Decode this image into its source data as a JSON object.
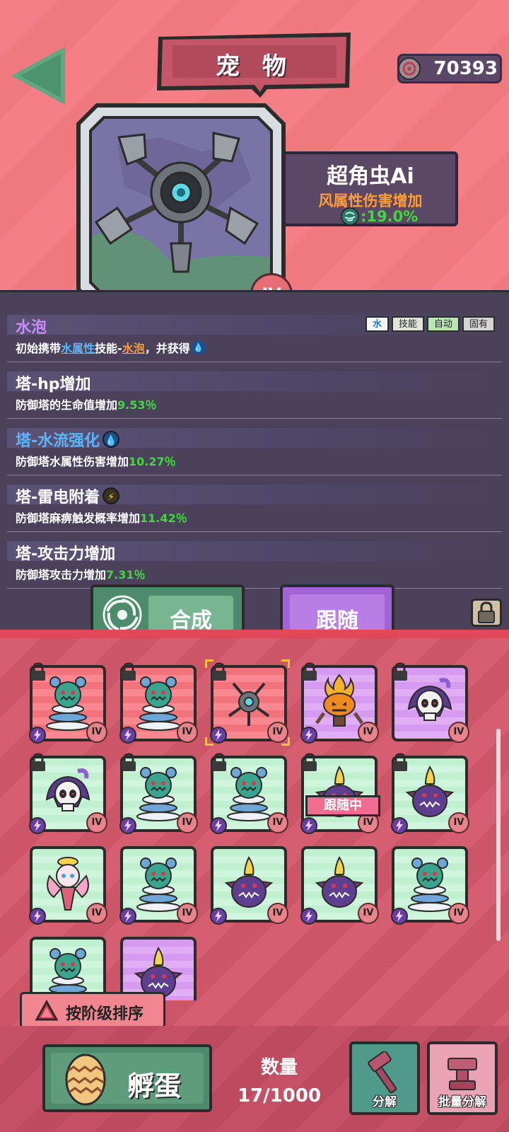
{
  "header": {
    "title": "宠 物",
    "currency": "70393"
  },
  "pet": {
    "name": "超角虫Ai",
    "attribute": "风属性伤害增加",
    "attribute_value": ":19.0%",
    "level": "IV"
  },
  "skills": [
    {
      "title": "水泡",
      "tags": [
        "水",
        "技能",
        "自动",
        "固有"
      ],
      "desc_parts": [
        "初始携带",
        "水属性",
        "技能-",
        "水泡",
        "，并获得"
      ]
    },
    {
      "title": "塔-hp增加",
      "desc": "防御塔的生命值增加",
      "value": "9.53％"
    },
    {
      "title": "塔-水流强化",
      "desc": "防御塔水属性伤害增加",
      "value": "10.27％"
    },
    {
      "title": "塔-雷电附着",
      "desc": "防御塔麻痹触发概率增加",
      "value": "11.42％"
    },
    {
      "title": "塔-攻击力增加",
      "desc": "防御塔攻击力增加",
      "value": "7.31％"
    }
  ],
  "actions": {
    "compose": "合成",
    "follow": "跟随"
  },
  "inventory": {
    "slot_level": "IV",
    "following_label": "跟随中",
    "sort_label": "按阶级排序"
  },
  "footer": {
    "hatch": "孵蛋",
    "count_title": "数量",
    "count_value": "17/1000",
    "decompose": "分解",
    "batch_decompose": "批量分解"
  },
  "colors": {
    "accent_green": "#3ddb38",
    "attribute_orange": "#ff9d3a",
    "panel": "#4b415a"
  }
}
